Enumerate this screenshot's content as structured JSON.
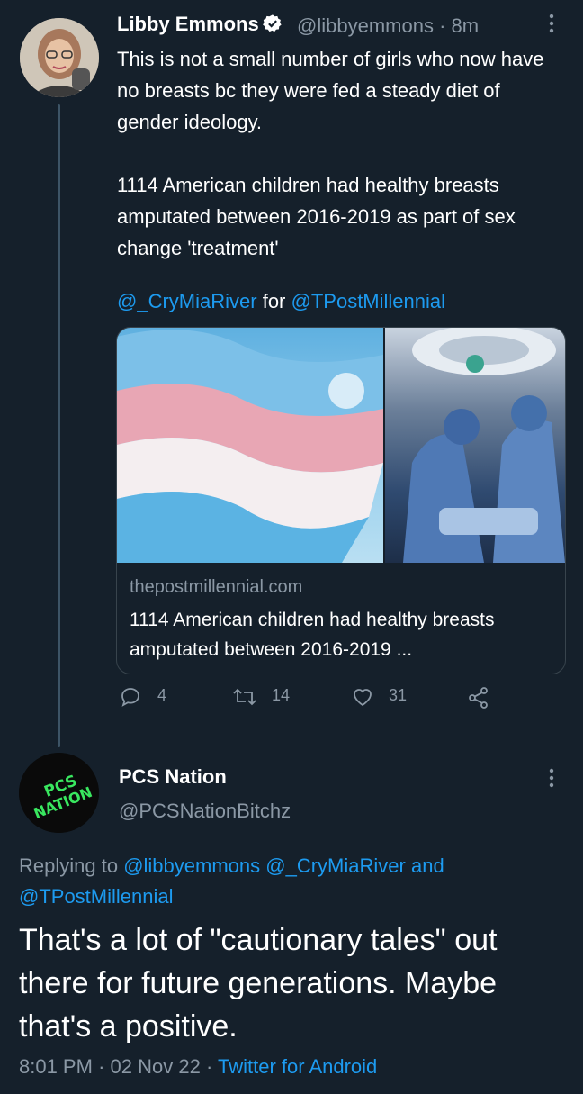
{
  "tweet": {
    "author_name": "Libby Emmons",
    "handle": "@libbyemmons",
    "time": "· 8m",
    "text": "This is not a small number of girls who now have no breasts bc they were fed a steady diet of gender ideology.\n\n1114 American children had healthy breasts amputated between 2016-2019 as part of sex change 'treatment'",
    "mention1": "@_CryMiaRiver",
    "mention_sep": "for",
    "mention2": "@TPostMillennial",
    "card": {
      "domain": "thepostmillennial.com",
      "title": "1114 American children had healthy breasts amputated between 2016-2019 ..."
    },
    "actions": {
      "replies": "4",
      "retweets": "14",
      "likes": "31"
    }
  },
  "reply": {
    "author_name": "PCS Nation",
    "handle": "@PCSNationBitchz",
    "avatar_text": "PCS NATION",
    "replying_to_label": "Replying to",
    "replying_to_1": "@libbyemmons",
    "replying_to_2": "@_CryMiaRiver",
    "replying_and": "and",
    "replying_to_3": "@TPostMillennial",
    "text": "That's a lot of \"cautionary tales\" out there for future generations. Maybe that's a positive.",
    "time": "8:01 PM",
    "date": "02 Nov 22",
    "source": "Twitter for Android"
  },
  "colors": {
    "background": "#15202b",
    "link": "#1d9bf0",
    "muted": "#8b98a5",
    "avatar_text": "#39e75f"
  }
}
